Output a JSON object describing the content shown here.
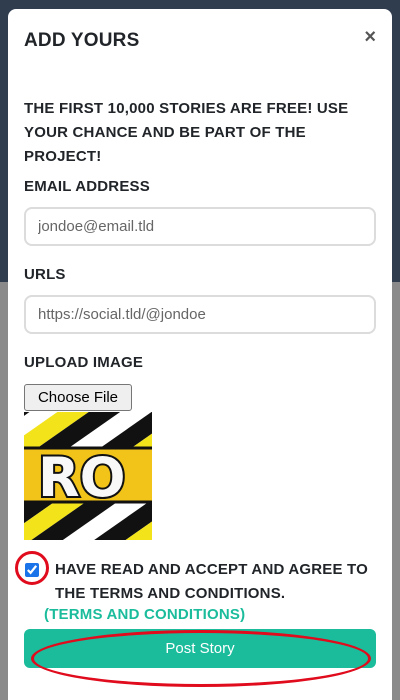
{
  "modal": {
    "title": "ADD YOURS",
    "close_symbol": "×",
    "intro": "THE FIRST 10,000 STORIES ARE FREE! USE YOUR CHANCE AND BE PART OF THE PROJECT!"
  },
  "form": {
    "email": {
      "label": "EMAIL ADDRESS",
      "placeholder": "jondoe@email.tld"
    },
    "urls": {
      "label": "URLS",
      "placeholder": "https://social.tld/@jondoe"
    },
    "upload": {
      "label": "UPLOAD IMAGE",
      "button_label": "Choose File",
      "preview_text": "RO"
    },
    "terms": {
      "checked": true,
      "text": "HAVE READ AND ACCEPT AND AGREE TO THE TERMS AND CONDITIONS.",
      "link_text": "(TERMS AND CONDITIONS)"
    },
    "submit_label": "Post Story"
  },
  "colors": {
    "accent": "#1abc9c",
    "annotation": "#e00b1c",
    "backdrop": "#2f3d4f"
  },
  "icons": {
    "close": "close-icon",
    "checkbox": "checkbox-checked"
  }
}
